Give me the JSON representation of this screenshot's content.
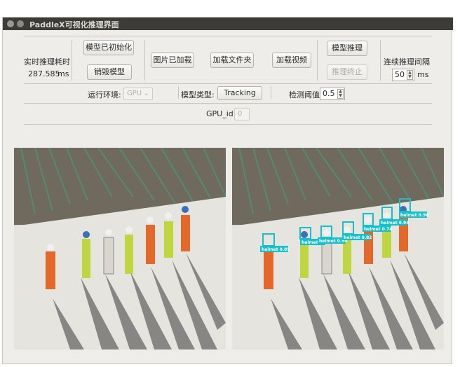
{
  "window": {
    "title": "PaddleX可视化推理界面"
  },
  "toolbar": {
    "latency_title": "实时推理耗时",
    "latency_value": "287.585",
    "latency_unit": "ms",
    "model_initialized": "模型已初始化",
    "destroy_model": "销毁模型",
    "image_loaded": "图片已加载",
    "load_folder": "加载文件夹",
    "load_video": "加载视频",
    "model_infer": "模型推理",
    "infer_stop": "推理终止",
    "interval_label": "连续推理间隔",
    "interval_value": "50",
    "interval_unit": "ms"
  },
  "settings": {
    "env_label": "运行环境:",
    "env_value": "GPU",
    "model_type_label": "模型类型:",
    "model_type_value": "Tracking",
    "threshold_label": "检测阈值",
    "threshold_value": "0.5",
    "gpu_id_label": "GPU_id",
    "gpu_id_value": "0"
  },
  "detections": [
    {
      "label": "helmet 0.85"
    },
    {
      "label": "helmet 0.9"
    },
    {
      "label": "helmet 0.90"
    },
    {
      "label": "helmet 0.82"
    },
    {
      "label": "helmet 0.74"
    },
    {
      "label": "helmet 0.94"
    },
    {
      "label": "helmet 0.96"
    }
  ],
  "colors": {
    "detection": "#17c0c8",
    "window_bg": "#efedea",
    "titlebar": "#3c3b37"
  }
}
